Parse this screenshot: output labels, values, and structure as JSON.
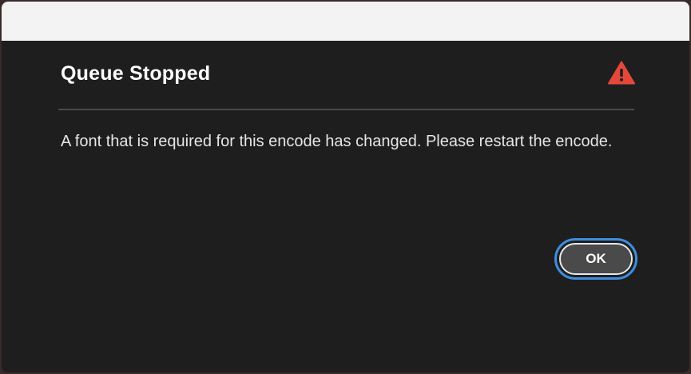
{
  "dialog": {
    "title": "Queue Stopped",
    "icon": "warning-triangle-icon",
    "message": "A font that is required for this encode has changed. Please restart the encode.",
    "ok_label": "OK"
  },
  "colors": {
    "dialog_background": "#1e1e1e",
    "titlebar_background": "#f3f3f3",
    "warning_icon": "#e5483a",
    "focus_ring": "#3d8fe0",
    "button_background": "#4a4a4a"
  }
}
